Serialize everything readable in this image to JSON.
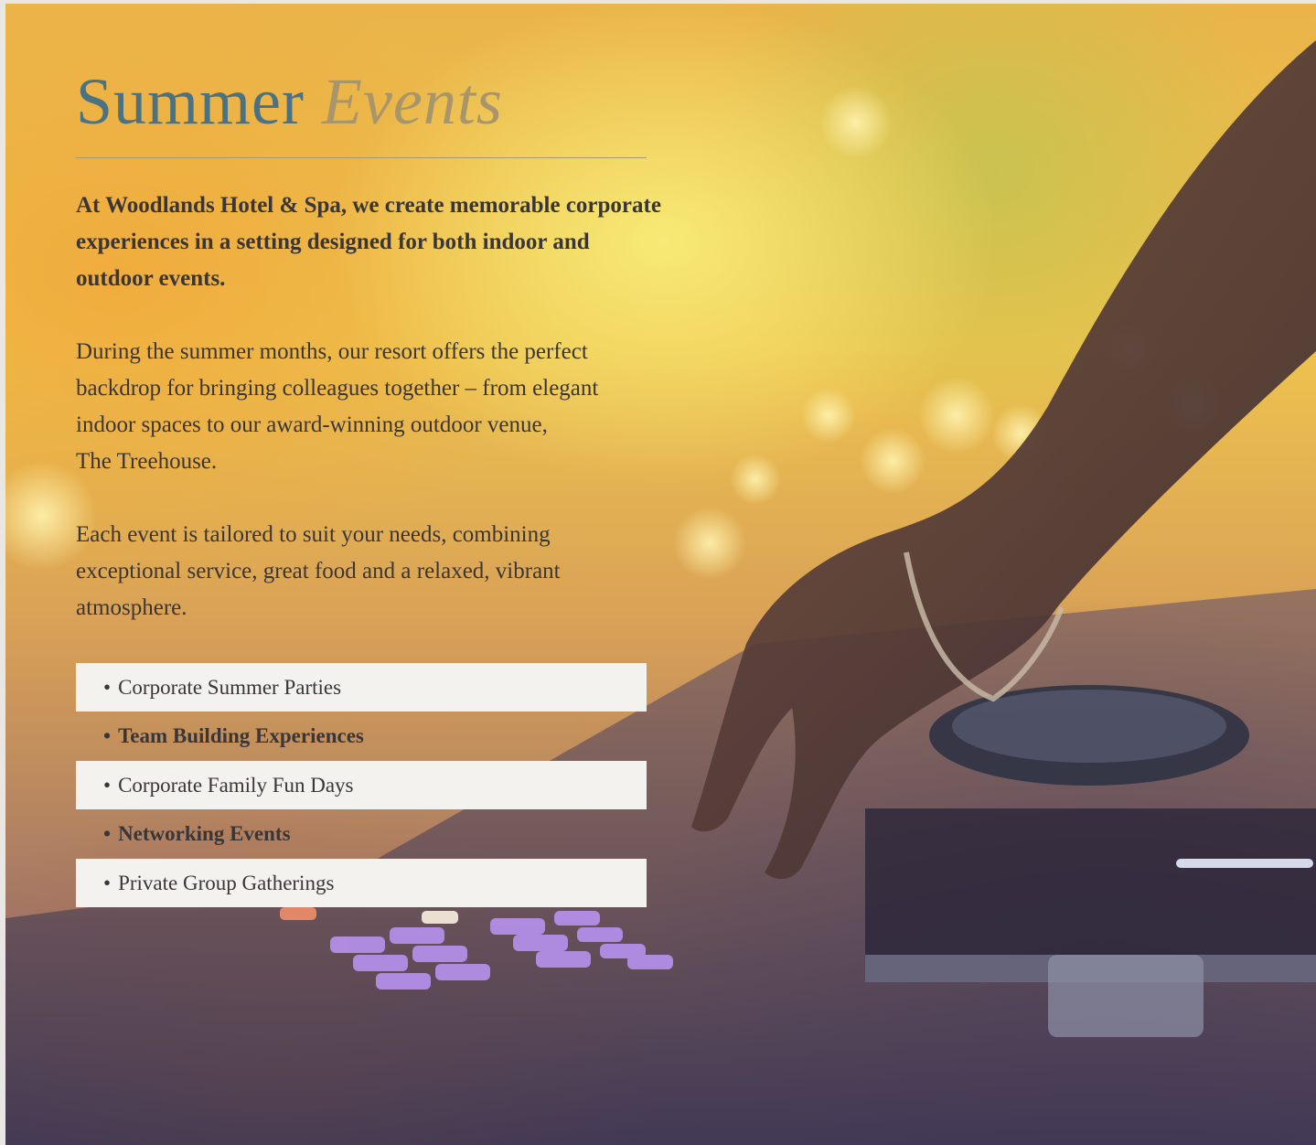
{
  "title": {
    "plain": "Summer",
    "accent": "Events"
  },
  "intro": "At Woodlands Hotel & Spa, we create memorable corporate experiences in a setting designed for both indoor and outdoor events.",
  "paragraph_1": {
    "lines": [
      "During the summer months, our resort offers the perfect",
      "backdrop for bringing colleagues together – from elegant",
      "indoor spaces to our award-winning outdoor venue,",
      "The Treehouse."
    ]
  },
  "paragraph_2": {
    "lines": [
      "Each event is tailored to suit your needs, combining",
      "exceptional service, great food and a relaxed, vibrant",
      "atmosphere."
    ]
  },
  "events": {
    "bullet": "•",
    "items": [
      "Corporate Summer Parties",
      "Team Building Experiences",
      "Corporate Family Fun Days",
      "Networking Events",
      "Private Group Gatherings"
    ]
  },
  "colors": {
    "title_plain": "#4b7282",
    "title_accent": "#a8956a",
    "text": "#3a3638",
    "list_box": "#f3f2ef"
  }
}
